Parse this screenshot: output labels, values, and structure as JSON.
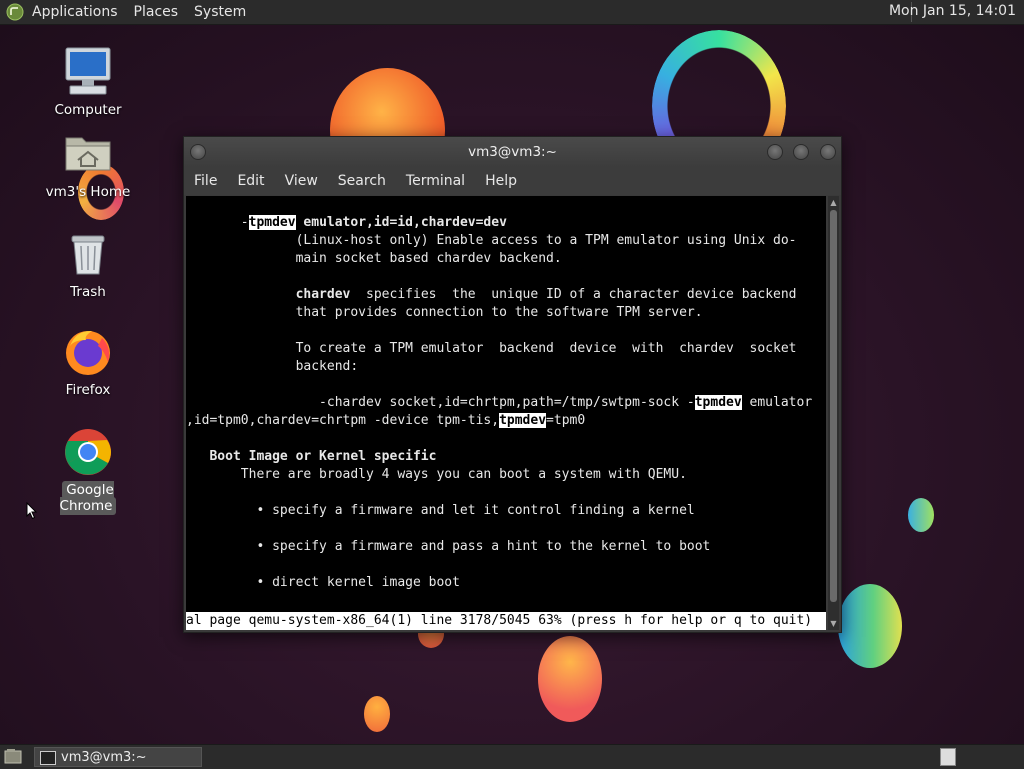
{
  "top_panel": {
    "menus": [
      "Applications",
      "Places",
      "System"
    ],
    "clock": "Mon Jan 15, 14:01"
  },
  "desktop": {
    "icons": [
      {
        "label": "Computer",
        "icon": "computer-icon"
      },
      {
        "label": "vm3's Home",
        "icon": "home-folder-icon"
      },
      {
        "label": "Trash",
        "icon": "trash-icon"
      },
      {
        "label": "Firefox",
        "icon": "firefox-icon"
      },
      {
        "label": "Google Chrome",
        "icon": "chrome-icon"
      }
    ]
  },
  "terminal": {
    "title": "vm3@vm3:~",
    "menu": [
      "File",
      "Edit",
      "View",
      "Search",
      "Terminal",
      "Help"
    ],
    "lines": [
      [
        {
          "t": ""
        }
      ],
      [
        {
          "t": "       -"
        },
        {
          "t": "tpmdev",
          "s": "hl"
        },
        {
          "t": " emulator,id=id,chardev=dev",
          "s": "b"
        }
      ],
      [
        {
          "t": "              (Linux-host only) Enable access to a TPM emulator using Unix do-"
        }
      ],
      [
        {
          "t": "              main socket based chardev backend."
        }
      ],
      [
        {
          "t": ""
        }
      ],
      [
        {
          "t": "              "
        },
        {
          "t": "chardev",
          "s": "b"
        },
        {
          "t": "  specifies  the  unique ID of a character device backend"
        }
      ],
      [
        {
          "t": "              that provides connection to the software TPM server."
        }
      ],
      [
        {
          "t": ""
        }
      ],
      [
        {
          "t": "              To create a TPM emulator  backend  device  with  chardev  socket"
        }
      ],
      [
        {
          "t": "              backend:"
        }
      ],
      [
        {
          "t": ""
        }
      ],
      [
        {
          "t": "                 -chardev socket,id=chrtpm,path=/tmp/swtpm-sock -"
        },
        {
          "t": "tpmdev",
          "s": "hl"
        },
        {
          "t": " emulator"
        }
      ],
      [
        {
          "t": ",id=tpm0,chardev=chrtpm -device tpm-tis,"
        },
        {
          "t": "tpmdev",
          "s": "hl"
        },
        {
          "t": "=tpm0"
        }
      ],
      [
        {
          "t": ""
        }
      ],
      [
        {
          "t": "   Boot Image or Kernel specific",
          "s": "b"
        }
      ],
      [
        {
          "t": "       There are broadly 4 ways you can boot a system with QEMU."
        }
      ],
      [
        {
          "t": ""
        }
      ],
      [
        {
          "t": "         • specify a firmware and let it control finding a kernel"
        }
      ],
      [
        {
          "t": ""
        }
      ],
      [
        {
          "t": "         • specify a firmware and pass a hint to the kernel to boot"
        }
      ],
      [
        {
          "t": ""
        }
      ],
      [
        {
          "t": "         • direct kernel image boot"
        }
      ],
      [
        {
          "t": ""
        }
      ]
    ],
    "status": "al page qemu-system-x86_64(1) line 3178/5045 63% (press h for help or q to quit)"
  },
  "bottom_panel": {
    "task_label": "vm3@vm3:~"
  },
  "colors": {
    "panel_bg": "#2b2b2b",
    "terminal_bg": "#000000",
    "terminal_fg": "#e8e8e8",
    "highlight_bg": "#ffffff"
  }
}
